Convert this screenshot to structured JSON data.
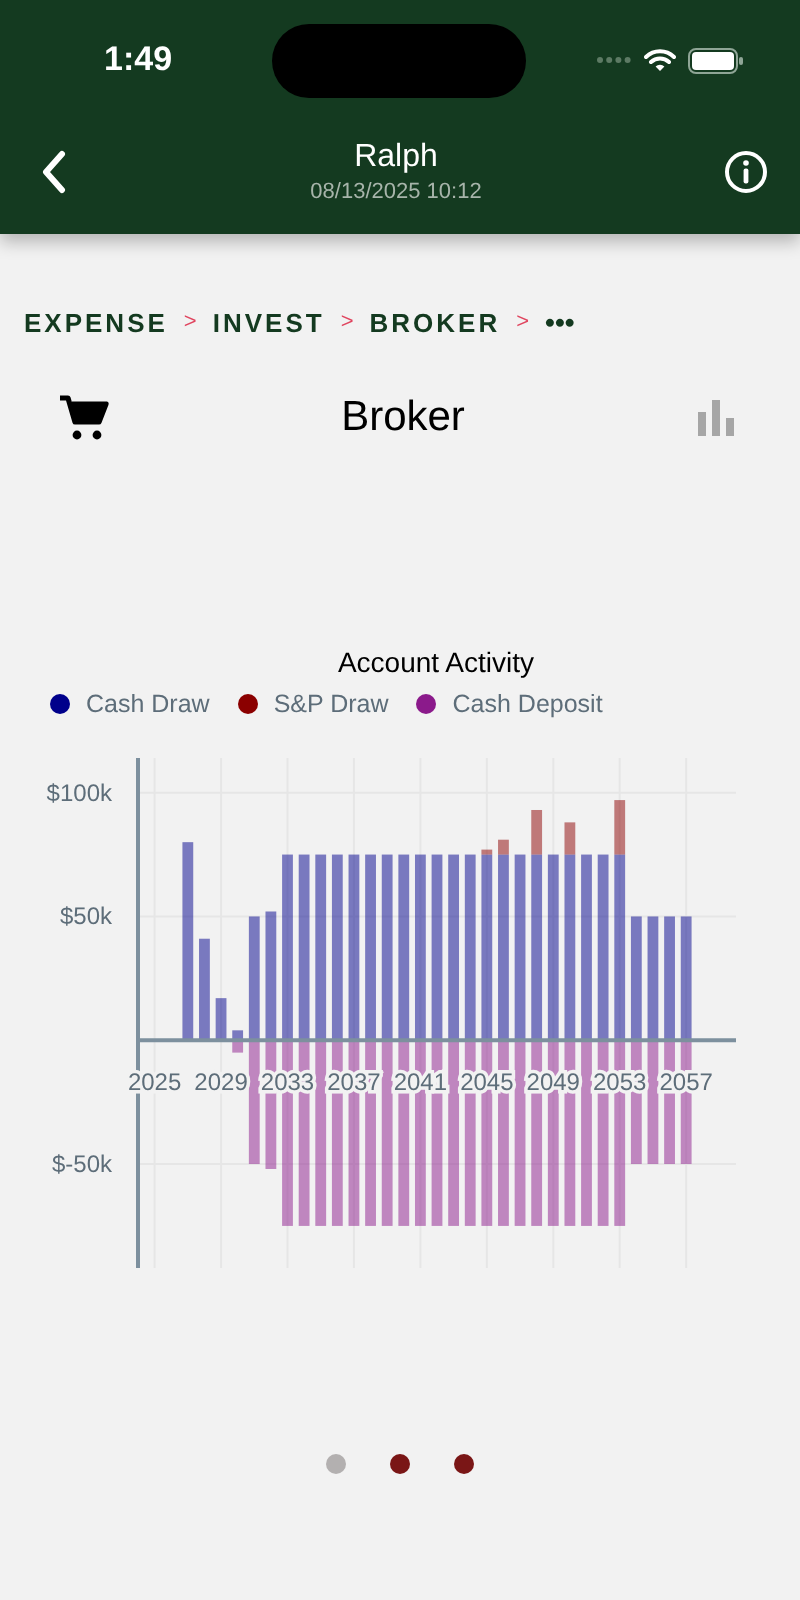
{
  "status_bar": {
    "time": "1:49"
  },
  "header": {
    "title": "Ralph",
    "subtitle": "08/13/2025 10:12"
  },
  "breadcrumb": [
    {
      "label": "EXPENSE",
      "separator": ">"
    },
    {
      "label": "INVEST",
      "separator": ">"
    },
    {
      "label": "BROKER",
      "separator": ">"
    }
  ],
  "breadcrumb_more": "•••",
  "page_title": "Broker",
  "chart": {
    "chart_data": {
      "type": "bar",
      "title": "Account Activity",
      "stacked": true,
      "x": [
        2027,
        2028,
        2029,
        2030,
        2031,
        2032,
        2033,
        2034,
        2035,
        2036,
        2037,
        2038,
        2039,
        2040,
        2041,
        2042,
        2043,
        2044,
        2045,
        2046,
        2047,
        2048,
        2049,
        2050,
        2051,
        2052,
        2053,
        2054,
        2055,
        2056,
        2057
      ],
      "series": [
        {
          "name": "Cash Draw",
          "color": "#00008b",
          "values": [
            80,
            41,
            17,
            4,
            50,
            52,
            75,
            75,
            75,
            75,
            75,
            75,
            75,
            75,
            75,
            75,
            75,
            75,
            75,
            75,
            75,
            75,
            75,
            75,
            75,
            75,
            75,
            50,
            50,
            50,
            50
          ]
        },
        {
          "name": "S&P Draw",
          "color": "#8b0000",
          "values": [
            null,
            null,
            null,
            null,
            null,
            null,
            null,
            null,
            null,
            null,
            null,
            null,
            null,
            null,
            null,
            null,
            null,
            null,
            2,
            6,
            null,
            18,
            null,
            13,
            null,
            null,
            22,
            null,
            null,
            null,
            null
          ]
        },
        {
          "name": "Cash Deposit",
          "color": "#8b1a8b",
          "values": [
            null,
            null,
            null,
            -5,
            -50,
            -52,
            -75,
            -75,
            -75,
            -75,
            -75,
            -75,
            -75,
            -75,
            -75,
            -75,
            -75,
            -75,
            -75,
            -75,
            -75,
            -75,
            -75,
            -75,
            -75,
            -75,
            -75,
            -50,
            -50,
            -50,
            -50
          ]
        }
      ],
      "grid": true,
      "legend": true,
      "xlim": [
        2024,
        2060
      ],
      "ylim": [
        -92,
        114
      ],
      "xticks": [
        2025,
        2029,
        2033,
        2037,
        2041,
        2045,
        2049,
        2053,
        2057
      ],
      "yticks": [
        {
          "value": 100,
          "label": "$100k"
        },
        {
          "value": 50,
          "label": "$50k"
        },
        {
          "value": -50,
          "label": "$-50k"
        }
      ]
    }
  },
  "page_dots": [
    {
      "selected": true
    },
    {
      "selected": false
    },
    {
      "selected": false
    }
  ]
}
